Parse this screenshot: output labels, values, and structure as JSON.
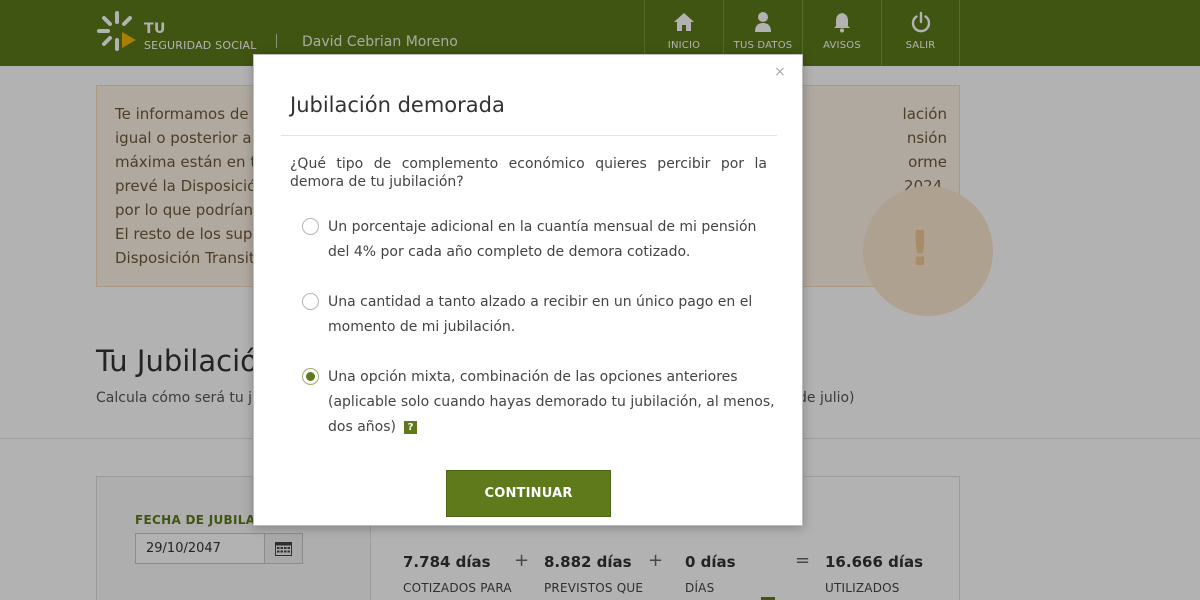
{
  "header": {
    "logo_line1": "TU",
    "logo_line2": "SEGURIDAD SOCIAL",
    "user_name": "David Cebrian Moreno",
    "nav": [
      {
        "label": "INICIO",
        "icon": "home-icon"
      },
      {
        "label": "TUS DATOS",
        "icon": "user-icon"
      },
      {
        "label": "AVISOS",
        "icon": "bell-icon"
      },
      {
        "label": "SALIR",
        "icon": "power-icon"
      }
    ]
  },
  "notice": {
    "lines": [
      "Te informamos de",
      "igual o posterior a",
      "máxima están en to",
      "prevé la Disposició",
      "por lo que podrían",
      "El resto de los supu",
      "Disposición Transit"
    ],
    "right_lines": [
      "lación",
      "nsión",
      "orme",
      "2024,"
    ]
  },
  "page": {
    "title": "Tu Jubilación",
    "subtitle": "Calcula cómo será tu ju",
    "subtitle_end": "de julio)"
  },
  "calculator": {
    "date_label": "FECHA DE JUBILACIO",
    "date_value": "29/10/2047",
    "days": [
      {
        "value": "7.784 días",
        "caption": "COTIZADOS PARA"
      },
      {
        "value": "8.882 días",
        "caption": "PREVISTOS QUE"
      },
      {
        "value": "0 días",
        "caption": "DÍAS"
      },
      {
        "value": "16.666 días",
        "caption": "UTILIZADOS"
      }
    ],
    "operators": [
      "+",
      "+",
      "="
    ]
  },
  "modal": {
    "close": "×",
    "title": "Jubilación demorada",
    "question": "¿Qué tipo de complemento económico quieres percibir por la demora de tu jubilación?",
    "options": [
      {
        "text": "Un porcentaje adicional en la cuantía mensual de mi pensión del 4% por cada año completo de demora cotizado.",
        "selected": false
      },
      {
        "text": "Una cantidad a tanto alzado a recibir en un único pago en el momento de mi jubilación.",
        "selected": false
      },
      {
        "text": "Una opción mixta, combinación de las opciones anteriores (aplicable solo cuando hayas demorado tu jubilación, al menos, dos años)",
        "selected": true,
        "help": "?"
      }
    ],
    "continue_label": "CONTINUAR"
  },
  "colors": {
    "brand_green": "#5e7a1a",
    "notice_bg": "#fdf3e6"
  }
}
